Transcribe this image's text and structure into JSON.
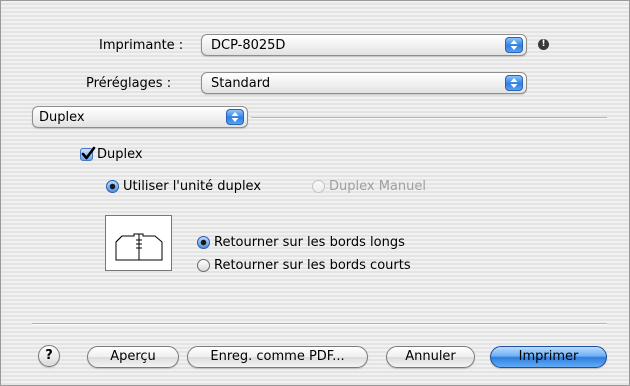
{
  "printer": {
    "label": "Imprimante :",
    "value": "DCP-8025D"
  },
  "presets": {
    "label": "Préréglages :",
    "value": "Standard"
  },
  "panel": {
    "value": "Duplex"
  },
  "duplex_checkbox": {
    "label": "Duplex",
    "checked": true
  },
  "duplex_mode": {
    "options": [
      {
        "label": "Utiliser l'unité duplex",
        "selected": true,
        "enabled": true
      },
      {
        "label": "Duplex Manuel",
        "selected": false,
        "enabled": false
      }
    ]
  },
  "binding": {
    "options": [
      {
        "label": "Retourner sur les bords longs",
        "selected": true
      },
      {
        "label": "Retourner sur les bords courts",
        "selected": false
      }
    ]
  },
  "buttons": {
    "help": "?",
    "preview": "Aperçu",
    "save_pdf": "Enreg. comme PDF...",
    "cancel": "Annuler",
    "print": "Imprimer"
  },
  "icons": {
    "warning": "exclamation-icon",
    "stepper": "updown-arrows-icon",
    "preview_image": "duplex-long-edge-icon"
  },
  "colors": {
    "accent": "#2f7fe3",
    "disabled_text": "#9f9f9f"
  }
}
